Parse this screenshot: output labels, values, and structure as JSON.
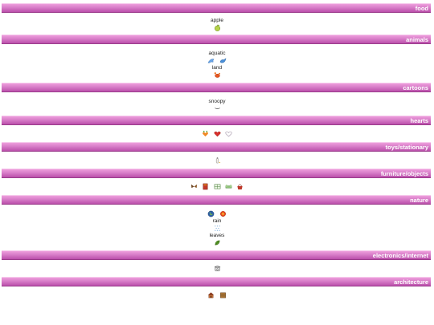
{
  "categories": {
    "food": {
      "title": "food",
      "label": "apple",
      "icons": [
        "apple-icon"
      ]
    },
    "animals": {
      "title": "animals",
      "groups": [
        {
          "label": "aquatic",
          "icons": [
            "dolphin-icon",
            "whale-icon"
          ]
        },
        {
          "label": "land",
          "icons": [
            "crab-icon"
          ]
        }
      ]
    },
    "cartoons": {
      "title": "cartoons",
      "label": "snoopy",
      "icons": [
        "snoopy-icon"
      ]
    },
    "hearts": {
      "title": "hearts",
      "icons": [
        "heart-bunch-icon",
        "red-heart-icon",
        "outline-heart-icon"
      ]
    },
    "toys": {
      "title": "toys/stationary",
      "icons": [
        "bottle-icon"
      ]
    },
    "furniture": {
      "title": "furniture/objects",
      "icons": [
        "butterfly-icon",
        "book-icon",
        "window-icon",
        "sofa-icon",
        "basket-icon"
      ]
    },
    "nature": {
      "title": "nature",
      "icons": [
        "earth-icon",
        "sun-icon"
      ],
      "groups": [
        {
          "label": "rain",
          "icons": [
            "raindrops-icon"
          ]
        },
        {
          "label": "leaves",
          "icons": [
            "leaf-icon"
          ]
        }
      ]
    },
    "electronics": {
      "title": "electronics/internet",
      "icons": [
        "telephone-icon"
      ]
    },
    "architecture": {
      "title": "architecture",
      "icons": [
        "house-icon",
        "building-icon"
      ]
    }
  }
}
